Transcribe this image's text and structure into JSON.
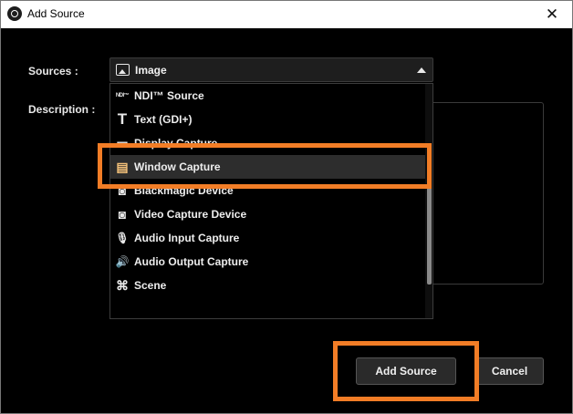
{
  "window": {
    "title": "Add Source",
    "close_glyph": "✕"
  },
  "form": {
    "sources_label": "Sources :",
    "description_label": "Description :",
    "selected_source": "Image"
  },
  "dropdown": {
    "items": [
      {
        "label": "NDI™ Source",
        "icon": "ndi-icon",
        "glyph": "NDI™"
      },
      {
        "label": "Text (GDI+)",
        "icon": "text-icon",
        "glyph": "T"
      },
      {
        "label": "Display Capture",
        "icon": "display-icon",
        "glyph": "▭"
      },
      {
        "label": "Window Capture",
        "icon": "window-icon",
        "glyph": "▤"
      },
      {
        "label": "Blackmagic Device",
        "icon": "camera-icon",
        "glyph": "◙"
      },
      {
        "label": "Video Capture Device",
        "icon": "camera-icon",
        "glyph": "◙"
      },
      {
        "label": "Audio Input Capture",
        "icon": "microphone-icon",
        "glyph": "🎙"
      },
      {
        "label": "Audio Output Capture",
        "icon": "speaker-icon",
        "glyph": "🔊"
      },
      {
        "label": "Scene",
        "icon": "scene-icon",
        "glyph": "⌘"
      }
    ],
    "selected_index": 3
  },
  "buttons": {
    "add_source": "Add Source",
    "cancel": "Cancel"
  },
  "colors": {
    "highlight": "#f27d26",
    "background": "#000000"
  }
}
